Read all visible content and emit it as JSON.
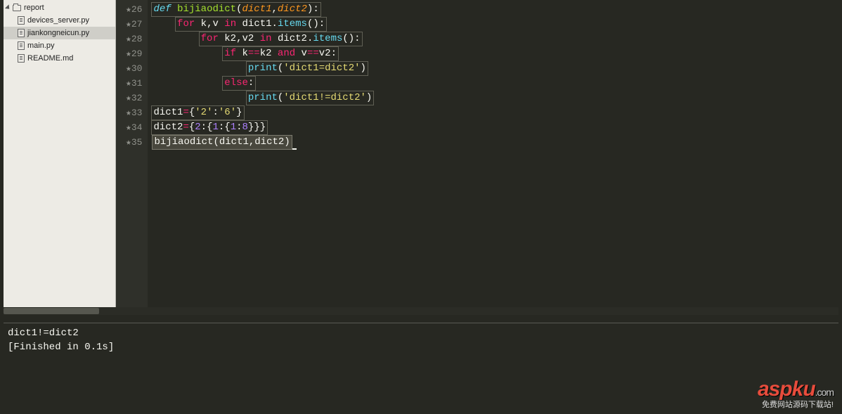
{
  "sidebar": {
    "folder": {
      "label": "report"
    },
    "files": [
      {
        "label": "devices_server.py",
        "selected": false
      },
      {
        "label": "jiankongneicun.py",
        "selected": true
      },
      {
        "label": "main.py",
        "selected": false
      },
      {
        "label": "README.md",
        "selected": false
      }
    ]
  },
  "gutter": {
    "lines": [
      "26",
      "27",
      "28",
      "29",
      "30",
      "31",
      "32",
      "33",
      "34",
      "35"
    ],
    "modified_prefix": "★"
  },
  "code": {
    "l26": {
      "def": "def",
      "fn": "bijiaodict",
      "p1": "dict1",
      "p2": "dict2"
    },
    "l27": {
      "kw": "for",
      "v1": "k",
      "v2": "v",
      "in": "in",
      "obj": "dict1",
      "call": "items"
    },
    "l28": {
      "kw": "for",
      "v1": "k2",
      "v2": "v2",
      "in": "in",
      "obj": "dict2",
      "call": "items"
    },
    "l29": {
      "kw": "if",
      "a": "k",
      "eq": "==",
      "b": "k2",
      "and": "and",
      "c": "v",
      "d": "v2"
    },
    "l30": {
      "call": "print",
      "str": "'dict1=dict2'"
    },
    "l31": {
      "kw": "else"
    },
    "l32": {
      "call": "print",
      "str": "'dict1!=dict2'"
    },
    "l33": {
      "var": "dict1",
      "eq": "=",
      "k": "'2'",
      "v": "'6'"
    },
    "l34": {
      "var": "dict2",
      "eq": "=",
      "n1": "2",
      "n2": "1",
      "n3": "1",
      "n4": "8"
    },
    "l35": {
      "call": "bijiaodict",
      "a": "dict1",
      "b": "dict2"
    }
  },
  "console": {
    "line1": "dict1!=dict2",
    "line2": "[Finished in 0.1s]"
  },
  "watermark": {
    "logo_a": "aspku",
    "logo_b": ".com",
    "sub": "免费网站源码下载站!"
  }
}
